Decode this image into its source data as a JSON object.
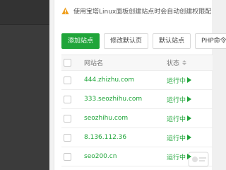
{
  "notice": {
    "text": "使用宝塔Linux面板创建站点时会自动创建权限配"
  },
  "toolbar": {
    "add_site": "添加站点",
    "edit_default_page": "修改默认页",
    "default_site": "默认站点",
    "php_cli": "PHP命令"
  },
  "table": {
    "headers": {
      "site_name": "网站名",
      "status": "状态"
    },
    "rows": [
      {
        "site": "444.zhizhu.com",
        "status": "运行中"
      },
      {
        "site": "333.seozhihu.com",
        "status": "运行中"
      },
      {
        "site": "seozhihu.com",
        "status": "运行中"
      },
      {
        "site": "8.136.112.36",
        "status": "运行中"
      },
      {
        "site": "seo200.cn",
        "status": "运行中"
      }
    ]
  },
  "colors": {
    "accent": "#20a53a",
    "sidebar": "#3b3b3b",
    "warning": "#f0a020"
  }
}
